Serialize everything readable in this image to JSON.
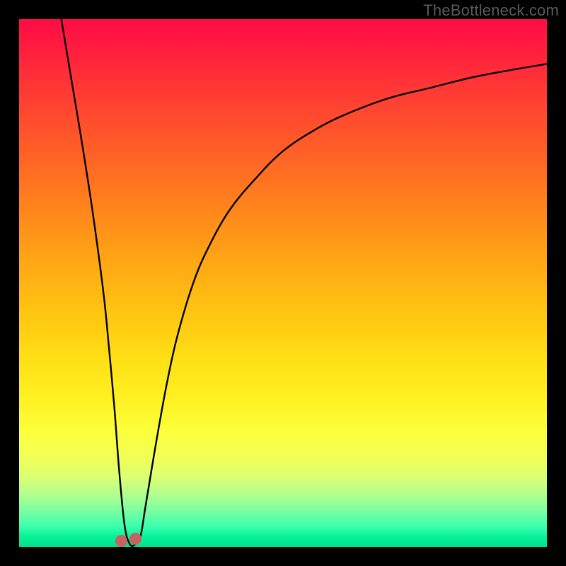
{
  "watermark": "TheBottleneck.com",
  "chart_data": {
    "type": "line",
    "title": "",
    "xlabel": "",
    "ylabel": "",
    "xlim": [
      0,
      100
    ],
    "ylim": [
      0,
      100
    ],
    "series": [
      {
        "name": "bottleneck-curve",
        "x": [
          8,
          10,
          12,
          14,
          16,
          17,
          18,
          19,
          20,
          21,
          22,
          23,
          24,
          26,
          28,
          30,
          33,
          36,
          40,
          45,
          50,
          56,
          62,
          70,
          78,
          86,
          94,
          100
        ],
        "y": [
          100,
          88,
          76,
          63,
          48,
          38,
          27,
          14,
          4,
          0.5,
          0.5,
          2,
          8,
          20,
          31,
          40,
          50,
          57,
          64,
          70,
          75,
          79,
          82,
          85,
          87,
          89,
          90.5,
          91.5
        ]
      }
    ],
    "markers": [
      {
        "name": "min-marker-left",
        "x": 19.4,
        "y": 1.2
      },
      {
        "name": "min-marker-right",
        "x": 22.0,
        "y": 1.6
      }
    ],
    "minimum": {
      "x": 20.5,
      "y": 0
    }
  },
  "colors": {
    "curve": "#000000",
    "marker": "#c86262",
    "frame": "#000000"
  }
}
